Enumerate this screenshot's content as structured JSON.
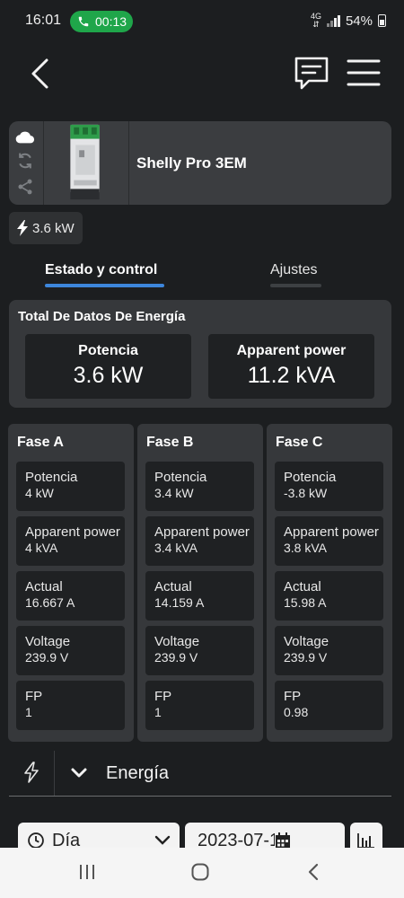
{
  "status_bar": {
    "time": "16:01",
    "call_timer": "00:13",
    "network": "4G",
    "battery": "54%"
  },
  "device": {
    "name": "Shelly Pro 3EM"
  },
  "power_chip": {
    "value": "3.6 kW"
  },
  "tabs": [
    {
      "label": "Estado y control"
    },
    {
      "label": "Ajustes"
    }
  ],
  "total": {
    "title": "Total De Datos De Energía",
    "boxes": [
      {
        "label": "Potencia",
        "value": "3.6 kW"
      },
      {
        "label": "Apparent power",
        "value": "11.2 kVA"
      }
    ]
  },
  "phases": [
    {
      "title": "Fase A",
      "metrics": [
        {
          "label": "Potencia",
          "value": "4 kW"
        },
        {
          "label": "Apparent power",
          "value": "4 kVA"
        },
        {
          "label": "Actual",
          "value": "16.667 A"
        },
        {
          "label": "Voltage",
          "value": "239.9 V"
        },
        {
          "label": "FP",
          "value": "1"
        }
      ]
    },
    {
      "title": "Fase B",
      "metrics": [
        {
          "label": "Potencia",
          "value": "3.4 kW"
        },
        {
          "label": "Apparent power",
          "value": "3.4 kVA"
        },
        {
          "label": "Actual",
          "value": "14.159 A"
        },
        {
          "label": "Voltage",
          "value": "239.9 V"
        },
        {
          "label": "FP",
          "value": "1"
        }
      ]
    },
    {
      "title": "Fase C",
      "metrics": [
        {
          "label": "Potencia",
          "value": "-3.8 kW"
        },
        {
          "label": "Apparent power",
          "value": "3.8 kVA"
        },
        {
          "label": "Actual",
          "value": "15.98 A"
        },
        {
          "label": "Voltage",
          "value": "239.9 V"
        },
        {
          "label": "FP",
          "value": "0.98"
        }
      ]
    }
  ],
  "energy": {
    "label": "Energía",
    "period": "Día",
    "date": "2023-07-17"
  },
  "colors": {
    "background": "#1c1e20",
    "panel": "#36383b",
    "box": "#1f2123",
    "accent": "#3d86dc",
    "call": "#1fa64a"
  },
  "icons": [
    "phone-icon",
    "back-arrow-icon",
    "chat-icon",
    "menu-icon",
    "cloud-icon",
    "sync-icon",
    "share-icon",
    "bolt-icon",
    "chevron-down-icon",
    "calendar-icon",
    "bar-chart-icon"
  ]
}
